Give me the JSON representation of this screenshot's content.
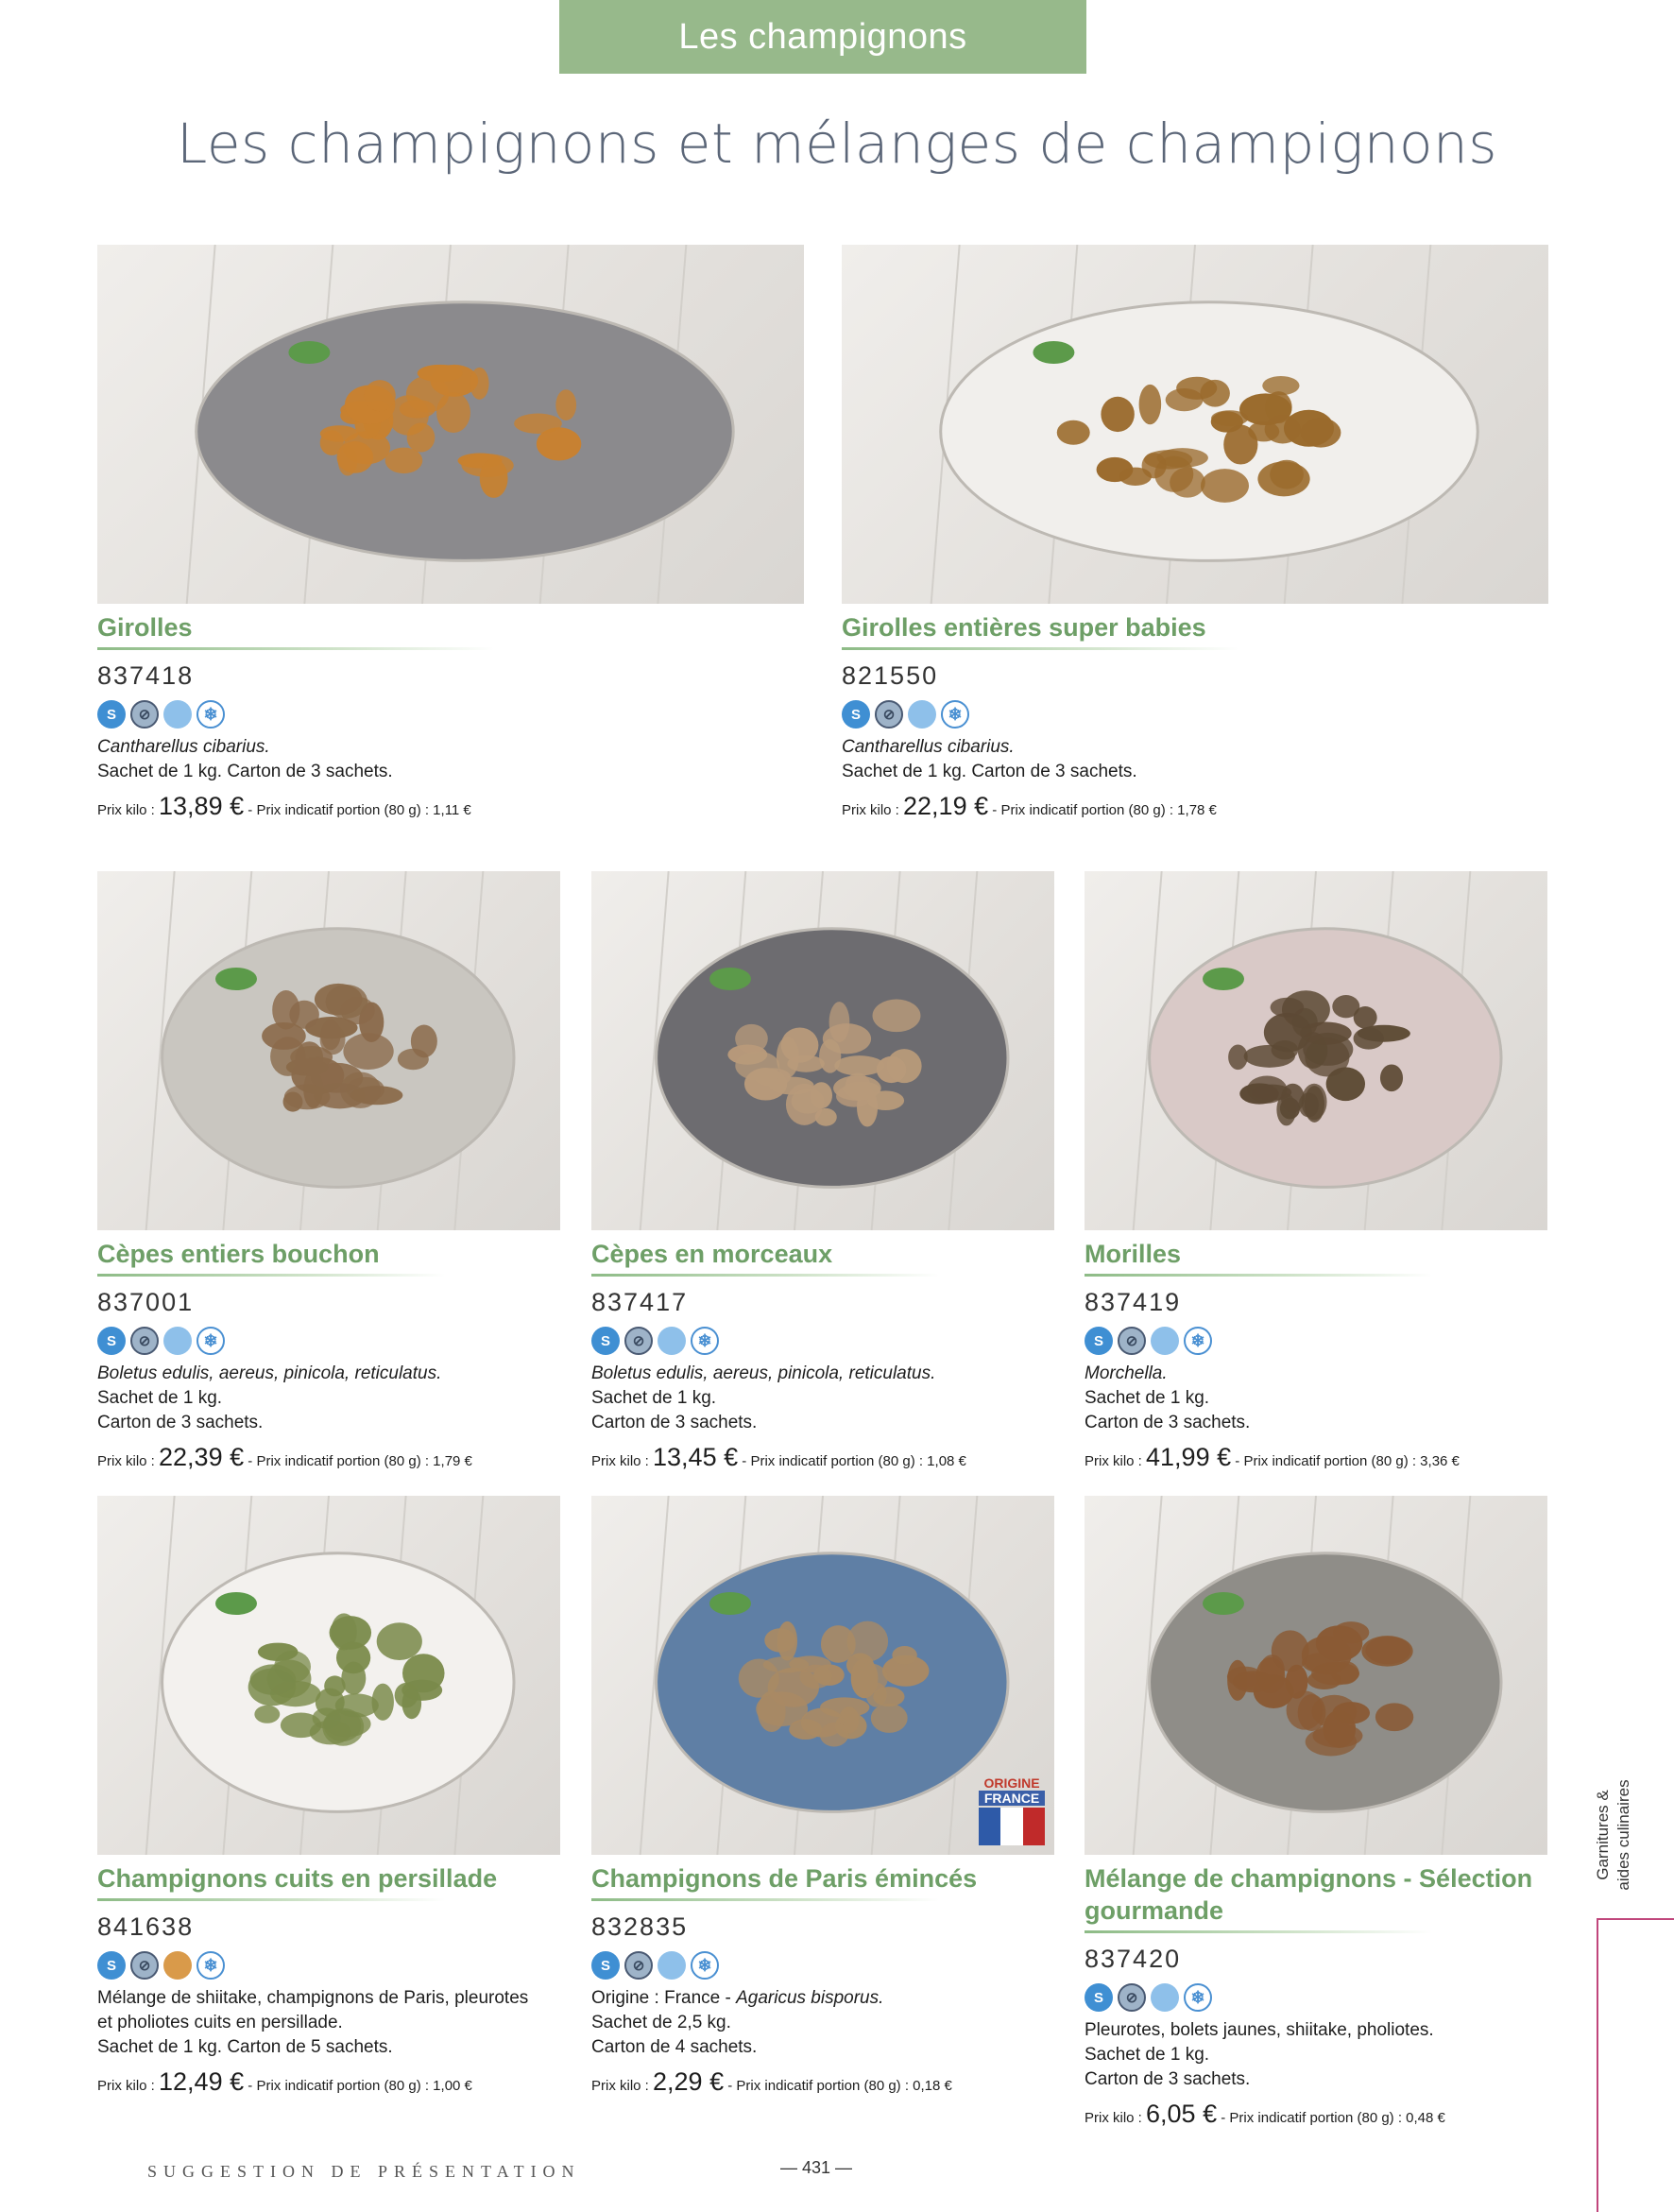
{
  "header": {
    "tab": "Les champignons",
    "title": "Les champignons et mélanges de champignons"
  },
  "products": [
    {
      "name": "Girolles",
      "code": "837418",
      "lines": [
        {
          "text": "Cantharellus cibarius.",
          "italic": true
        },
        {
          "text": "Sachet de 1 kg. Carton de 3 sachets.",
          "italic": false
        }
      ],
      "price_label": "Prix kilo : ",
      "price_value": "13,89 €",
      "portion": " - Prix indicatif portion (80 g) : 1,11 €",
      "icons": [
        "s-icon",
        "no-freeze-icon",
        "blue-circle-icon",
        "snowflake-icon"
      ]
    },
    {
      "name": "Girolles entières super babies",
      "code": "821550",
      "lines": [
        {
          "text": "Cantharellus cibarius.",
          "italic": true
        },
        {
          "text": "Sachet de 1 kg. Carton de 3 sachets.",
          "italic": false
        }
      ],
      "price_label": "Prix kilo : ",
      "price_value": "22,19 €",
      "portion": " - Prix indicatif portion (80 g) : 1,78 €",
      "icons": [
        "s-icon",
        "no-freeze-icon",
        "blue-circle-icon",
        "snowflake-icon"
      ]
    },
    {
      "name": "Cèpes entiers bouchon",
      "code": "837001",
      "lines": [
        {
          "text": "Boletus edulis, aereus, pinicola, reticulatus.",
          "italic": true
        },
        {
          "text": "Sachet de 1 kg.",
          "italic": false
        },
        {
          "text": "Carton de 3 sachets.",
          "italic": false
        }
      ],
      "price_label": "Prix kilo : ",
      "price_value": "22,39 €",
      "portion": " - Prix indicatif portion (80 g) : 1,79 €",
      "icons": [
        "s-icon",
        "no-freeze-icon",
        "blue-circle-icon",
        "snowflake-icon"
      ]
    },
    {
      "name": "Cèpes en morceaux",
      "code": "837417",
      "lines": [
        {
          "text": "Boletus edulis, aereus, pinicola, reticulatus.",
          "italic": true
        },
        {
          "text": "Sachet de 1 kg.",
          "italic": false
        },
        {
          "text": "Carton de 3 sachets.",
          "italic": false
        }
      ],
      "price_label": "Prix kilo : ",
      "price_value": "13,45 €",
      "portion": " - Prix indicatif portion (80 g) : 1,08 €",
      "icons": [
        "s-icon",
        "no-freeze-icon",
        "blue-circle-icon",
        "snowflake-icon"
      ]
    },
    {
      "name": "Morilles",
      "code": "837419",
      "lines": [
        {
          "text": "Morchella.",
          "italic": true
        },
        {
          "text": "Sachet de 1 kg.",
          "italic": false
        },
        {
          "text": "Carton de 3 sachets.",
          "italic": false
        }
      ],
      "price_label": "Prix kilo : ",
      "price_value": "41,99 €",
      "portion": " - Prix indicatif portion (80 g) : 3,36 €",
      "icons": [
        "s-icon",
        "no-freeze-icon",
        "blue-circle-icon",
        "snowflake-icon"
      ]
    },
    {
      "name": "Champignons cuits en persillade",
      "code": "841638",
      "lines": [
        {
          "text": "Mélange de shiitake, champignons de Paris, pleurotes",
          "italic": false
        },
        {
          "text": "et pholiotes cuits en persillade.",
          "italic": false
        },
        {
          "text": "Sachet de 1 kg. Carton de 5 sachets.",
          "italic": false
        }
      ],
      "price_label": "Prix kilo : ",
      "price_value": "12,49 €",
      "portion": " - Prix indicatif portion (80 g) : 1,00 €",
      "icons": [
        "s-icon",
        "no-freeze-icon",
        "orange-circle-icon",
        "snowflake-icon"
      ]
    },
    {
      "name": "Champignons de Paris émincés",
      "code": "832835",
      "lines": [
        {
          "text": "Origine : France - ",
          "italic": false,
          "italic_suffix": "Agaricus bisporus."
        },
        {
          "text": "Sachet de 2,5 kg.",
          "italic": false
        },
        {
          "text": "Carton de 4 sachets.",
          "italic": false
        }
      ],
      "price_label": "Prix kilo : ",
      "price_value": "2,29 €",
      "portion": " - Prix indicatif portion (80 g) : 0,18 €",
      "icons": [
        "s-icon",
        "no-freeze-icon",
        "blue-circle-icon",
        "snowflake-icon"
      ],
      "badge": {
        "line1": "ORIGINE",
        "line2": "FRANCE"
      }
    },
    {
      "name": "Mélange de champignons - Sélection gourmande",
      "code": "837420",
      "lines": [
        {
          "text": "Pleurotes, bolets jaunes, shiitake, pholiotes.",
          "italic": false
        },
        {
          "text": "Sachet de 1 kg.",
          "italic": false
        },
        {
          "text": "Carton de 3 sachets.",
          "italic": false
        }
      ],
      "price_label": "Prix kilo : ",
      "price_value": "6,05 €",
      "portion": " - Prix indicatif portion (80 g) : 0,48 €",
      "icons": [
        "s-icon",
        "no-freeze-icon",
        "blue-circle-icon",
        "snowflake-icon"
      ]
    }
  ],
  "side": {
    "line1": "Garnitures &",
    "line2": "aides culinaires"
  },
  "footer": {
    "suggestion": "SUGGESTION DE PRÉSENTATION",
    "page": "— 431 —"
  }
}
